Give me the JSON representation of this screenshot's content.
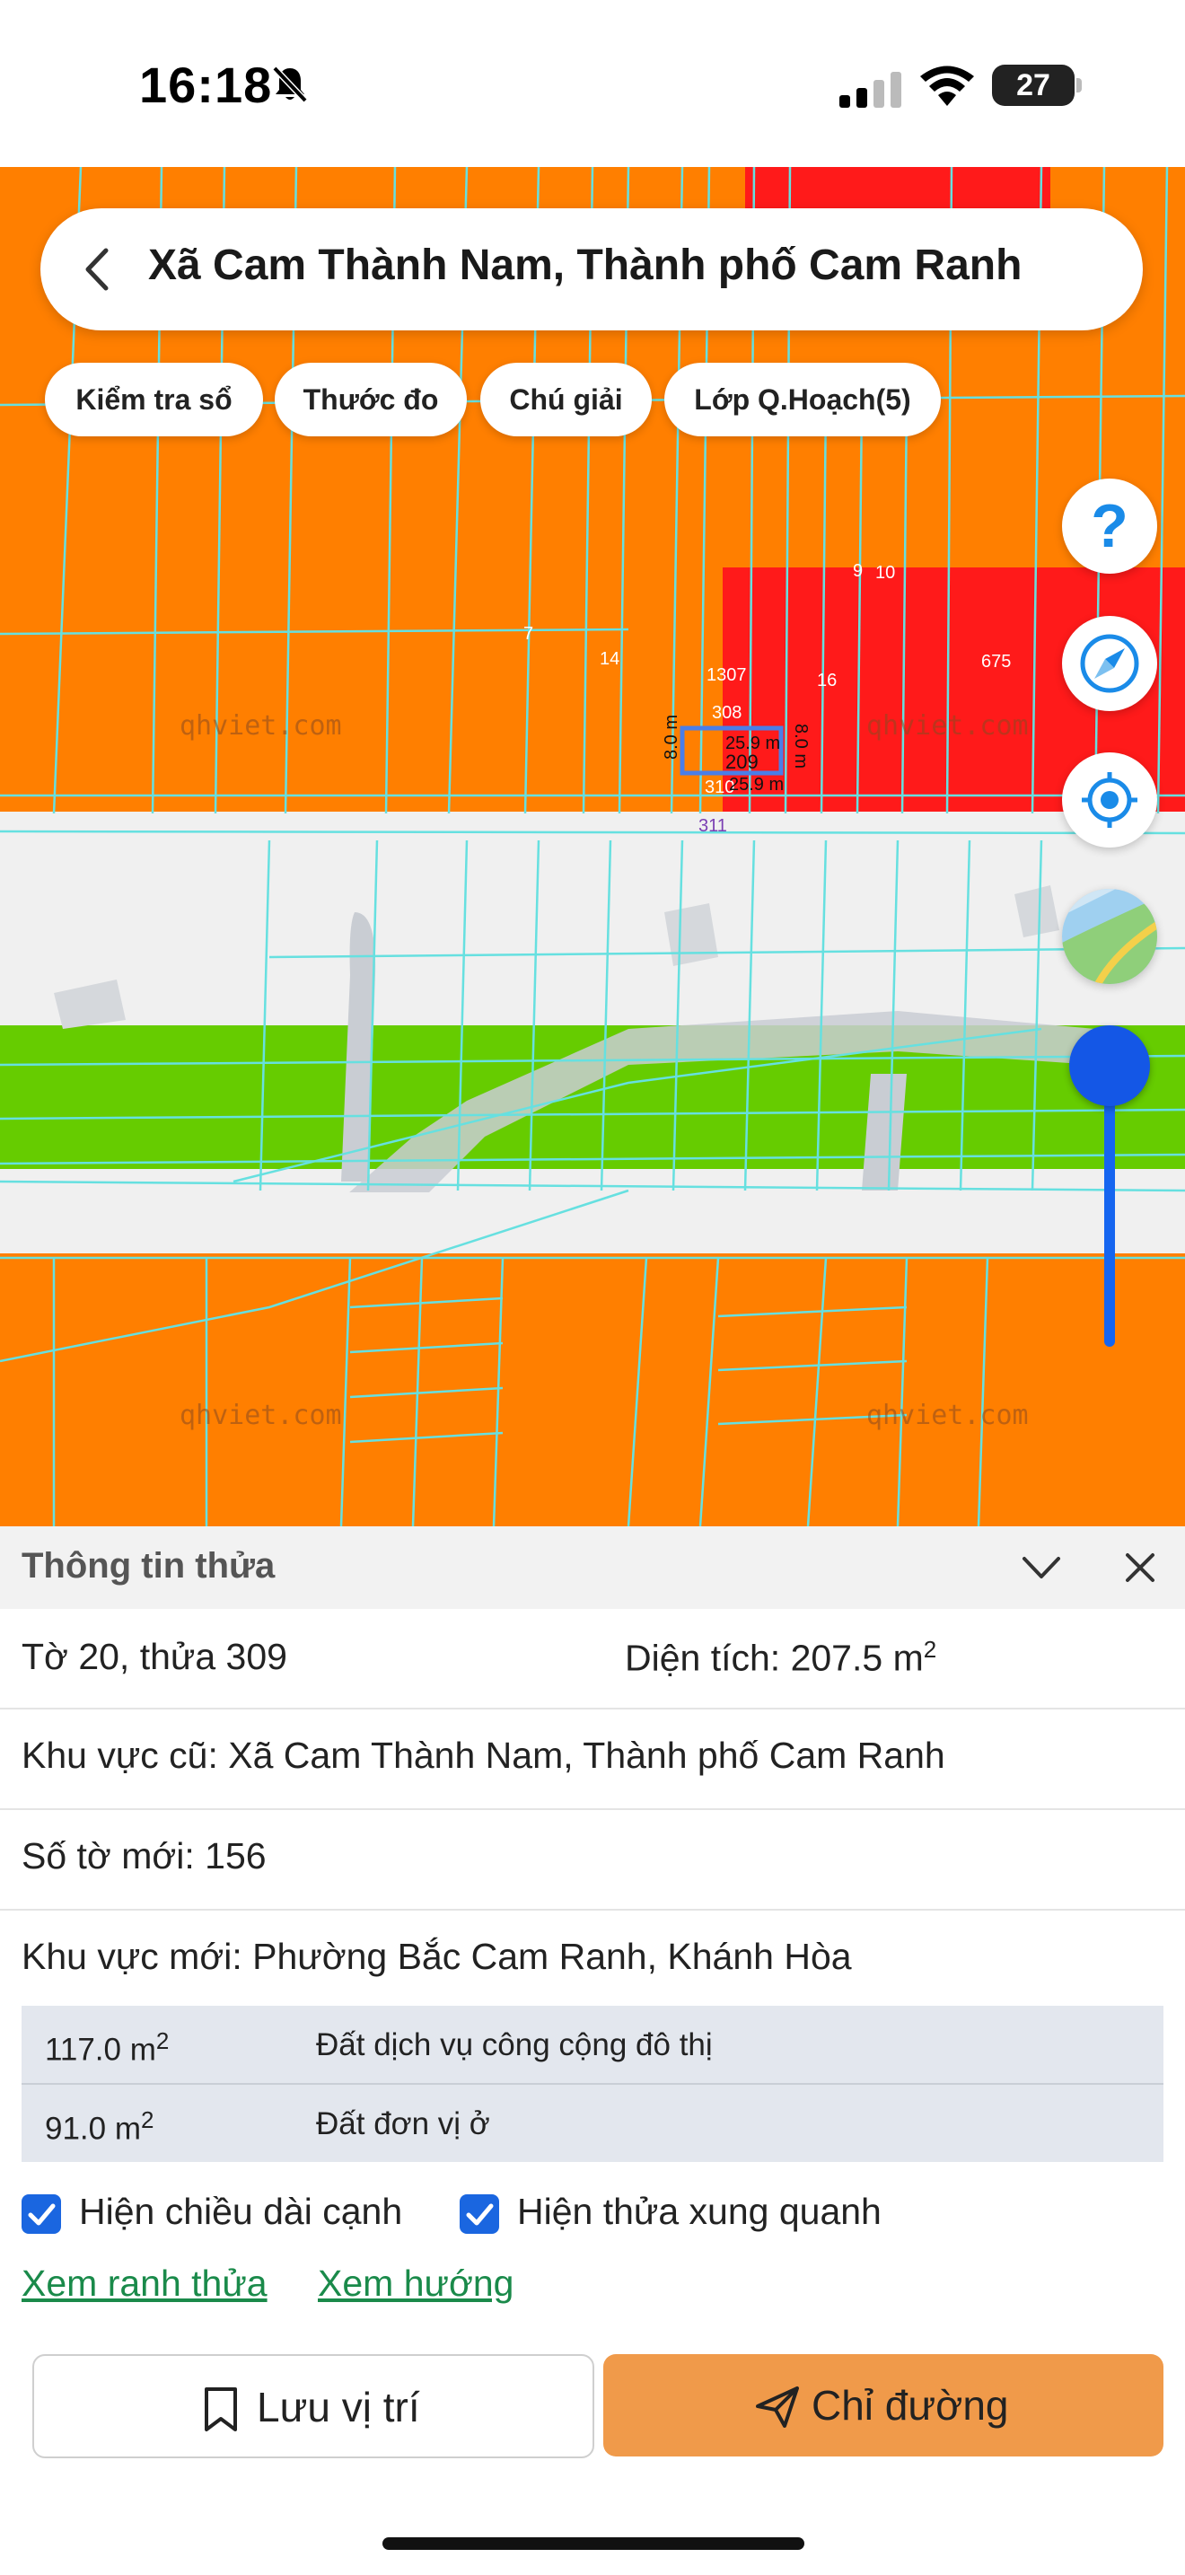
{
  "status_bar": {
    "time": "16:18",
    "battery": "27"
  },
  "search": {
    "title": "Xã Cam Thành Nam, Thành phố Cam Ranh"
  },
  "chips": [
    "Kiểm tra sổ",
    "Thước đo",
    "Chú giải",
    "Lớp Q.Hoạch(5)"
  ],
  "map": {
    "watermark": "qhviet.com",
    "parcel_numbers": [
      "9",
      "10",
      "7",
      "14",
      "1307",
      "16",
      "675",
      "308",
      "209",
      "310",
      "311"
    ],
    "edge_lengths": [
      "8.0 m",
      "25.9 m",
      "8.0 m",
      "25.9 m"
    ],
    "colors": {
      "residential": "#ff7f00",
      "public_service": "#ff1a1a",
      "green": "#66cc00",
      "road": "#f0f0f0",
      "parcel_lines": "#66e0e0"
    }
  },
  "panel": {
    "title": "Thông tin thửa",
    "sheet_parcel": "Tờ 20, thửa 309",
    "area_label": "Diện tích: 207.5 m",
    "area_unit_sup": "2",
    "old_area": "Khu vực cũ: Xã Cam Thành Nam, Thành phố Cam Ranh",
    "new_sheet": "Số tờ mới: 156",
    "new_area": "Khu vực mới: Phường Bắc Cam Ranh, Khánh Hòa",
    "zones": [
      {
        "area": "117.0 m",
        "sup": "2",
        "type": "Đất dịch vụ công cộng đô thị"
      },
      {
        "area": "91.0 m",
        "sup": "2",
        "type": "Đất đơn vị ở"
      }
    ],
    "checkbox_edges": "Hiện chiều dài cạnh",
    "checkbox_neighbors": "Hiện thửa xung quanh",
    "link_boundary": "Xem ranh thửa",
    "link_direction": "Xem hướng",
    "save_label": "Lưu vị trí",
    "directions_label": "Chỉ đường",
    "accent": "#1a66e0",
    "primary_button": "#f09a4a"
  }
}
